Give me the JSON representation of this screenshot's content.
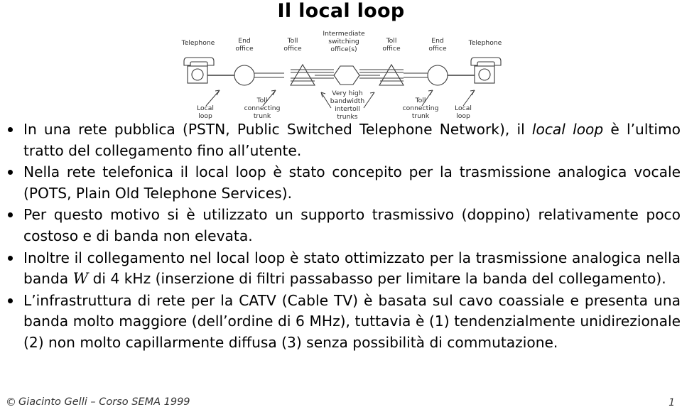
{
  "slide": {
    "title": "Il local loop",
    "page_number": "1"
  },
  "diagram": {
    "name": "pstn-hierarchy-diagram",
    "top_labels": [
      {
        "id": "telephone-left",
        "lines": [
          "Telephone"
        ]
      },
      {
        "id": "end-office-left",
        "lines": [
          "End",
          "office"
        ]
      },
      {
        "id": "toll-office-left",
        "lines": [
          "Toll",
          "office"
        ]
      },
      {
        "id": "intermediate-switching-office",
        "lines": [
          "Intermediate",
          "switching",
          "office(s)"
        ]
      },
      {
        "id": "toll-office-right",
        "lines": [
          "Toll",
          "office"
        ]
      },
      {
        "id": "end-office-right",
        "lines": [
          "End",
          "office"
        ]
      },
      {
        "id": "telephone-right",
        "lines": [
          "Telephone"
        ]
      }
    ],
    "bottom_labels": [
      {
        "id": "local-loop-left",
        "lines": [
          "Local",
          "loop"
        ]
      },
      {
        "id": "toll-connecting-trunk-left",
        "lines": [
          "Toll",
          "connecting",
          "trunk"
        ]
      },
      {
        "id": "intertoll-trunks",
        "lines": [
          "Very high",
          "bandwidth",
          "intertoll",
          "trunks"
        ]
      },
      {
        "id": "toll-connecting-trunk-right",
        "lines": [
          "Toll",
          "connecting",
          "trunk"
        ]
      },
      {
        "id": "local-loop-right",
        "lines": [
          "Local",
          "loop"
        ]
      }
    ],
    "stroke_color": "#3a3a3a"
  },
  "bullets": [
    {
      "id": "bullet-pstn",
      "segments": [
        {
          "text": "In una rete pubblica (PSTN, Public Switched Telephone Network), il ",
          "style": "normal"
        },
        {
          "text": "local loop",
          "style": "italic"
        },
        {
          "text": " è l’ultimo tratto del collegamento fino all’utente.",
          "style": "normal"
        }
      ]
    },
    {
      "id": "bullet-pots",
      "segments": [
        {
          "text": "Nella rete telefonica il local loop è stato concepito per la trasmissione analogica vocale (POTS, Plain Old Telephone Services).",
          "style": "normal"
        }
      ]
    },
    {
      "id": "bullet-doppino",
      "segments": [
        {
          "text": "Per questo motivo si è utilizzato un supporto trasmissivo (doppino) relativamente poco costoso e di banda non elevata.",
          "style": "normal"
        }
      ]
    },
    {
      "id": "bullet-banda-w",
      "segments": [
        {
          "text": "Inoltre il collegamento nel local loop è stato ottimizzato per la trasmissione analogica nella banda ",
          "style": "normal"
        },
        {
          "text": "W",
          "style": "math"
        },
        {
          "text": " di 4 kHz (inserzione di filtri passabasso per limitare la banda del collegamento).",
          "style": "normal"
        }
      ]
    },
    {
      "id": "bullet-catv",
      "segments": [
        {
          "text": "L’infrastruttura di rete per la CATV (Cable TV) è basata sul cavo coassiale e presenta una banda molto maggiore (dell’ordine di 6 MHz), tuttavia è (1) tendenzialmente unidirezionale (2) non molto capillarmente diffusa (3) senza possibilità di commutazione.",
          "style": "normal"
        }
      ]
    }
  ],
  "footer": {
    "copyright_symbol": "©",
    "credit": "Giacinto Gelli – Corso SEMA 1999",
    "page_number": "1"
  }
}
